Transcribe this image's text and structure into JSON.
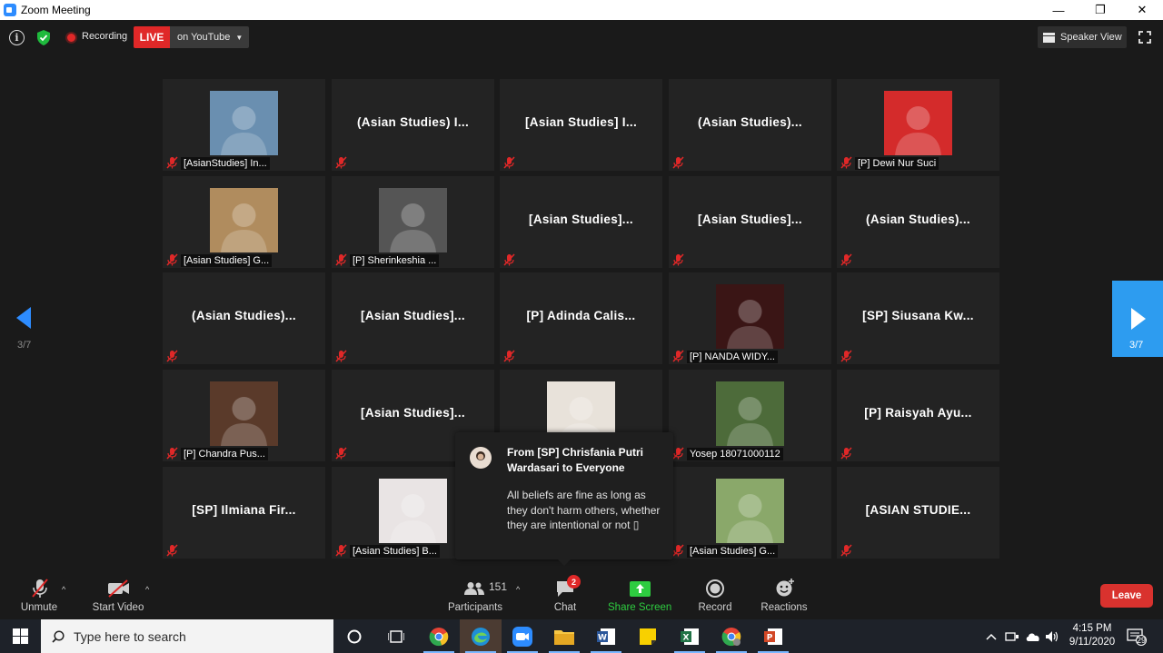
{
  "window": {
    "title": "Zoom Meeting",
    "minimize": "—",
    "restore": "❐",
    "close": "✕"
  },
  "topbar": {
    "recording_label": "Recording",
    "live_label": "LIVE",
    "stream_target": "on YouTube",
    "speaker_view_label": "Speaker View"
  },
  "tiles": [
    {
      "label": "[AsianStudies] In...",
      "photo": true,
      "photo_color": "#6a8fb0"
    },
    {
      "name": "(Asian Studies) I...",
      "photo": false
    },
    {
      "name": "[Asian Studies] I...",
      "photo": false
    },
    {
      "name": "(Asian Studies)...",
      "photo": false
    },
    {
      "label": "[P] Dewi Nur Suci",
      "photo": true,
      "photo_color": "#d42b2b"
    },
    {
      "label": "[Asian Studies] G...",
      "photo": true,
      "photo_color": "#b08c5e"
    },
    {
      "label": "[P] Sherinkeshia ...",
      "photo": true,
      "photo_color": "#555555"
    },
    {
      "name": "[Asian Studies]...",
      "photo": false
    },
    {
      "name": "[Asian Studies]...",
      "photo": false
    },
    {
      "name": "(Asian Studies)...",
      "photo": false
    },
    {
      "name": "(Asian Studies)...",
      "photo": false
    },
    {
      "name": "[Asian Studies]...",
      "photo": false
    },
    {
      "name": "[P] Adinda Calis...",
      "photo": false
    },
    {
      "label": "[P] NANDA WIDY...",
      "photo": true,
      "photo_color": "#3a1515"
    },
    {
      "name": "[SP] Siusana Kw...",
      "photo": false
    },
    {
      "label": "[P] Chandra Pus...",
      "photo": true,
      "photo_color": "#5a3a2a"
    },
    {
      "name": "[Asian Studies]...",
      "photo": false
    },
    {
      "label": "",
      "photo": true,
      "photo_color": "#e8e2da"
    },
    {
      "label": "Yosep 18071000112",
      "photo": true,
      "photo_color": "#4d6b3a"
    },
    {
      "name": "[P] Raisyah Ayu...",
      "photo": false
    },
    {
      "name": "[SP] Ilmiana Fir...",
      "photo": false
    },
    {
      "label": "[Asian Studies] B...",
      "photo": true,
      "photo_color": "#e9e4e4"
    },
    {
      "label": "",
      "photo": false
    },
    {
      "label": "[Asian Studies] G...",
      "photo": true,
      "photo_color": "#8aa86a"
    },
    {
      "name": "[ASIAN STUDIE...",
      "photo": false
    }
  ],
  "pagination": {
    "left_page": "3/7",
    "right_page": "3/7"
  },
  "chat_popup": {
    "from": "From [SP] Chrisfania Putri Wardasari to Everyone",
    "message": "All beliefs are fine as long as they don't harm others, whether they are intentional or not ▯"
  },
  "toolbar": {
    "unmute": "Unmute",
    "start_video": "Start Video",
    "participants_count": "151",
    "participants": "Participants",
    "chat": "Chat",
    "chat_badge": "2",
    "share_screen": "Share Screen",
    "record": "Record",
    "reactions": "Reactions",
    "leave": "Leave"
  },
  "taskbar": {
    "search_placeholder": "Type here to search",
    "time": "4:15 PM",
    "date": "9/11/2020",
    "notification_count": "29"
  },
  "colors": {
    "accent": "#2d8cff",
    "live_red": "#e02828",
    "share_green": "#2ecc40",
    "leave_red": "#d9322e"
  }
}
